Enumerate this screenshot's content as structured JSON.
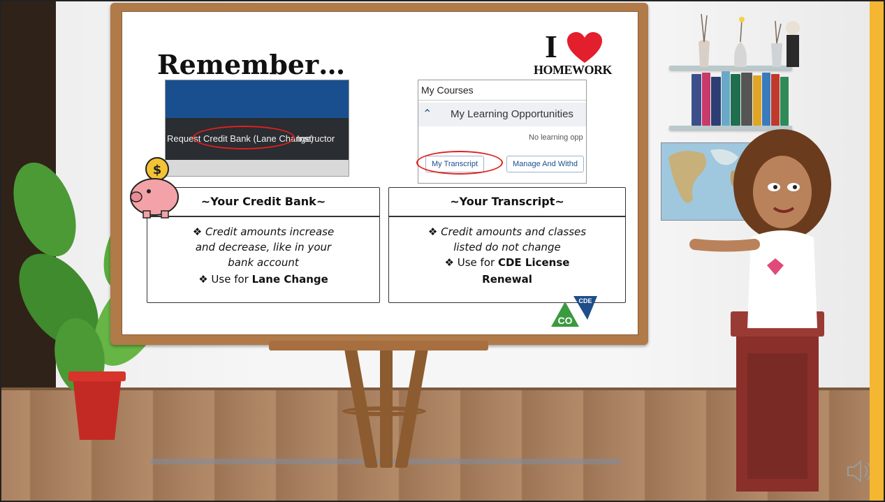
{
  "slide": {
    "title": "Remember…",
    "logo": {
      "i": "I",
      "heart_color": "#e31e2d",
      "word": "HOMEWORK"
    },
    "screenshot_credit_bank": {
      "nav_items": [
        "Request",
        "Credit Bank (Lane Change)",
        "Instructor"
      ],
      "highlight": "Credit Bank (Lane Change)"
    },
    "screenshot_transcript": {
      "header": "My Courses",
      "section": "My Learning Opportunities",
      "empty_text": "No learning opp",
      "buttons": [
        "My Transcript",
        "Manage And Withd"
      ],
      "highlight": "My Transcript"
    },
    "credit_bank_box": {
      "title": "~Your Credit Bank~",
      "lines": [
        "❖  Credit amounts increase",
        "and decrease, like in your",
        "bank account",
        "❖ Use for "
      ],
      "bold": "Lane Change"
    },
    "transcript_box": {
      "title": "~Your Transcript~",
      "lines": [
        "❖ Credit amounts and classes",
        "listed do not change",
        "❖ Use for "
      ],
      "bold1": "CDE License",
      "bold2": "Renewal"
    },
    "cde_logo": {
      "top": "CDE",
      "co": "CO"
    }
  },
  "colors": {
    "accent_red": "#e32020",
    "board_wood": "#b07a49",
    "side_bar": "#f5b731",
    "nav_blue": "#1a4f8f"
  },
  "icons": [
    "piggy-bank-icon",
    "speaker-icon",
    "heart-icon",
    "cde-logo"
  ]
}
